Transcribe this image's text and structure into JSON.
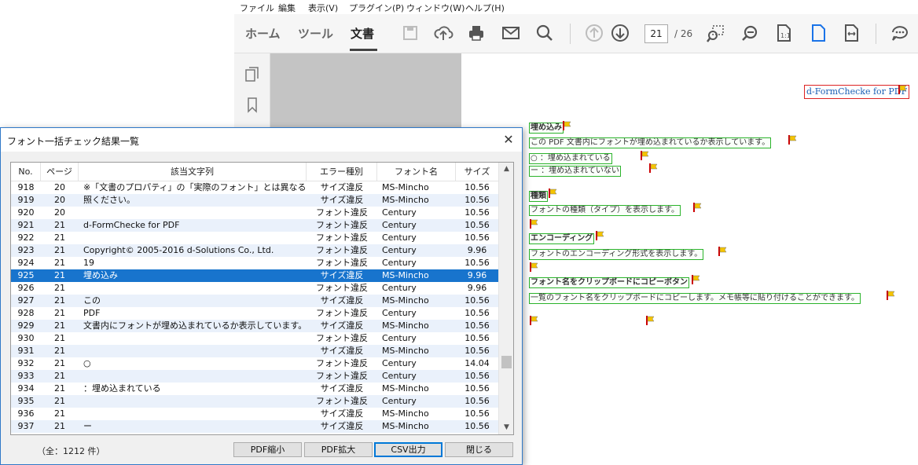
{
  "menu": [
    "ファイル",
    "編集",
    "表示(V)",
    "プラグイン(P)",
    "ウィンドウ(W)",
    "ヘルプ(H)"
  ],
  "tabs": {
    "home": "ホーム",
    "tools": "ツール",
    "document": "文書"
  },
  "toolbar": {
    "page_current": "21",
    "page_total": "/ 26"
  },
  "pdf": {
    "header": "d-FormChecke for PDF",
    "lines": [
      "埋め込み",
      "この PDF 文書内にフォントが埋め込まれているか表示しています。",
      "○   ：埋め込まれている",
      "ー   ：埋め込まれていない",
      "種類",
      "フォントの種類（タイプ）を表示します。",
      "エンコーディング",
      "フォントのエンコーディング形式を表示します。",
      "フォント名をクリップボードにコピーボタン",
      "一覧のフォント名をクリップボードにコピーします。メモ帳等に貼り付けることができます。"
    ]
  },
  "dialog": {
    "title": "フォント一括チェック結果一覧",
    "close": "✕",
    "columns": [
      "No.",
      "ページ",
      "該当文字列",
      "エラー種別",
      "フォント名",
      "サイズ"
    ],
    "rows": [
      {
        "no": "918",
        "page": "20",
        "text": "※「文書のプロパティ」の「実際のフォント」とは異なる場合...",
        "err": "サイズ違反",
        "font": "MS-Mincho",
        "size": "10.56"
      },
      {
        "no": "919",
        "page": "20",
        "text": "照ください。",
        "err": "サイズ違反",
        "font": "MS-Mincho",
        "size": "10.56"
      },
      {
        "no": "920",
        "page": "20",
        "text": "",
        "err": "フォント違反",
        "font": "Century",
        "size": "10.56"
      },
      {
        "no": "921",
        "page": "21",
        "text": "d-FormChecke for PDF",
        "err": "フォント違反",
        "font": "Century",
        "size": "10.56"
      },
      {
        "no": "922",
        "page": "21",
        "text": "",
        "err": "フォント違反",
        "font": "Century",
        "size": "10.56"
      },
      {
        "no": "923",
        "page": "21",
        "text": "Copyright© 2005-2016 d-Solutions Co., Ltd.",
        "err": "フォント違反",
        "font": "Century",
        "size": "9.96"
      },
      {
        "no": "924",
        "page": "21",
        "text": "19",
        "err": "フォント違反",
        "font": "Century",
        "size": "10.56"
      },
      {
        "no": "925",
        "page": "21",
        "text": "埋め込み",
        "err": "サイズ違反",
        "font": "MS-Mincho",
        "size": "9.96"
      },
      {
        "no": "926",
        "page": "21",
        "text": "",
        "err": "フォント違反",
        "font": "Century",
        "size": "9.96"
      },
      {
        "no": "927",
        "page": "21",
        "text": "この",
        "err": "サイズ違反",
        "font": "MS-Mincho",
        "size": "10.56"
      },
      {
        "no": "928",
        "page": "21",
        "text": "PDF",
        "err": "フォント違反",
        "font": "Century",
        "size": "10.56"
      },
      {
        "no": "929",
        "page": "21",
        "text": "文書内にフォントが埋め込まれているか表示しています。",
        "err": "サイズ違反",
        "font": "MS-Mincho",
        "size": "10.56"
      },
      {
        "no": "930",
        "page": "21",
        "text": "",
        "err": "フォント違反",
        "font": "Century",
        "size": "10.56"
      },
      {
        "no": "931",
        "page": "21",
        "text": "",
        "err": "サイズ違反",
        "font": "MS-Mincho",
        "size": "10.56"
      },
      {
        "no": "932",
        "page": "21",
        "text": "○",
        "err": "フォント違反",
        "font": "Century",
        "size": "14.04"
      },
      {
        "no": "933",
        "page": "21",
        "text": "",
        "err": "フォント違反",
        "font": "Century",
        "size": "10.56"
      },
      {
        "no": "934",
        "page": "21",
        "text": "：埋め込まれている",
        "err": "サイズ違反",
        "font": "MS-Mincho",
        "size": "10.56"
      },
      {
        "no": "935",
        "page": "21",
        "text": "",
        "err": "フォント違反",
        "font": "Century",
        "size": "10.56"
      },
      {
        "no": "936",
        "page": "21",
        "text": "",
        "err": "サイズ違反",
        "font": "MS-Mincho",
        "size": "10.56"
      },
      {
        "no": "937",
        "page": "21",
        "text": "ー",
        "err": "サイズ違反",
        "font": "MS-Mincho",
        "size": "10.56"
      }
    ],
    "selected_no": "925",
    "count": "（全：1212 件）",
    "buttons": [
      "PDF縮小",
      "PDF拡大",
      "CSV出力",
      "閉じる"
    ]
  },
  "colors": {
    "selection": "#1874cd",
    "accent": "#2f78c8",
    "ok_box": "#2bb32b",
    "flag": "#d22"
  }
}
